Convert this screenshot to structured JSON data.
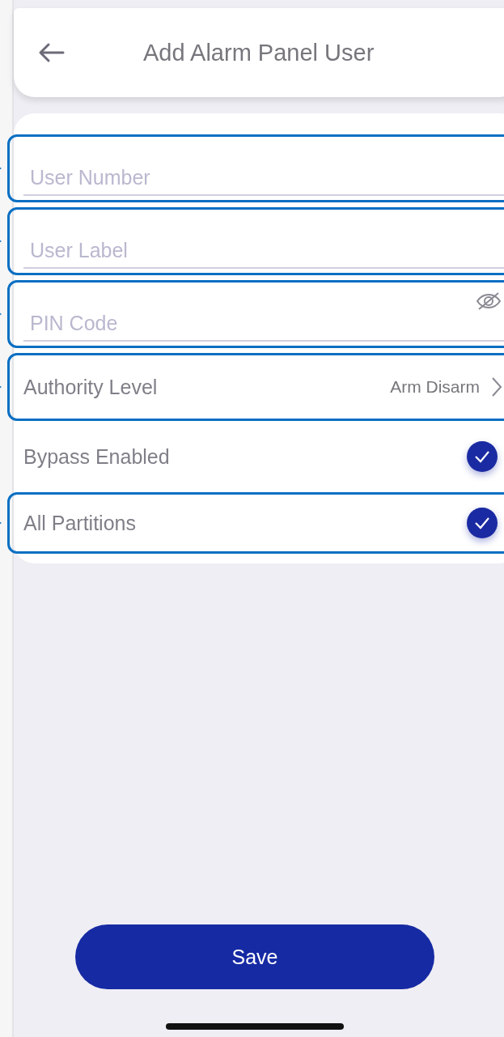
{
  "header": {
    "title": "Add Alarm Panel User"
  },
  "rows": [
    {
      "kind": "input",
      "placeholder": "User Number",
      "highlighted": true
    },
    {
      "kind": "input",
      "placeholder": "User Label",
      "highlighted": true
    },
    {
      "kind": "password",
      "placeholder": "PIN Code",
      "highlighted": true
    },
    {
      "kind": "select",
      "label": "Authority Level",
      "value": "Arm Disarm",
      "highlighted": true
    },
    {
      "kind": "check",
      "label": "Bypass Enabled",
      "checked": true,
      "highlighted": false
    },
    {
      "kind": "check",
      "label": "All Partitions",
      "checked": true,
      "highlighted": true
    }
  ],
  "save_button": "Save"
}
